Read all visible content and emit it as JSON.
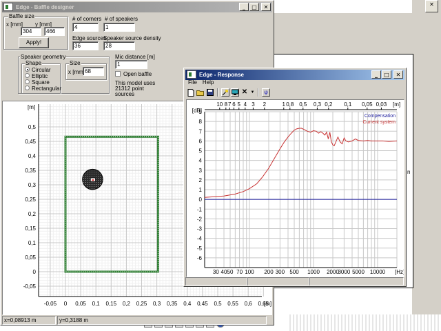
{
  "baffle_window": {
    "title": "Edge - Baffle designer",
    "baffle_size": {
      "group": "Baffle size",
      "x_label": "x [mm]",
      "y_label": "y [mm]",
      "x_value": "304",
      "y_value": "466",
      "apply_label": "Apply!"
    },
    "corners_label": "# of corners",
    "corners_value": "4",
    "speakers_label": "# of speakers",
    "speakers_value": "1",
    "edge_sources_label": "Edge sources",
    "edge_sources_value": "36",
    "density_label": "Speaker source density",
    "density_value": "28",
    "speaker_geometry": {
      "group": "Speaker geometry",
      "shape_group": "Shape",
      "shapes": [
        "Circular",
        "Elliptic",
        "Square",
        "Rectangular"
      ],
      "selected_shape": "Circular",
      "size_group": "Size",
      "size_label": "x [mm]",
      "size_value": "68"
    },
    "mic_distance_label": "Mic distance [m]",
    "mic_distance_value": "1",
    "open_baffle_label": "Open baffle",
    "point_sources_text": [
      "This model uses",
      "21312 point",
      "sources"
    ],
    "plot": {
      "y_unit": "[m]",
      "x_unit": "[m]",
      "y_ticks": [
        "0,5",
        "0,45",
        "0,4",
        "0,35",
        "0,3",
        "0,25",
        "0,2",
        "0,15",
        "0,1",
        "0,05",
        "0",
        "-0,05"
      ],
      "x_ticks": [
        "-0,05",
        "0",
        "0,05",
        "0,1",
        "0,15",
        "0,2",
        "0,25",
        "0,3",
        "0,35",
        "0,4",
        "0,45",
        "0,5",
        "0,55",
        "0,6",
        "0,65"
      ]
    },
    "status_x": "x=0,08913 m",
    "status_y": "y=0,3188 m"
  },
  "response_window": {
    "title": "Edge - Response",
    "menu": [
      "File",
      "Help"
    ],
    "toolbar_icons": [
      "new-file-icon",
      "open-folder-icon",
      "save-disk-icon",
      "star-icon",
      "monitor-icon",
      "delete-x-icon",
      "dropdown-arrow-icon",
      "phi-icon"
    ],
    "legend": [
      {
        "name": "Compensation",
        "color": "#1c1c9c"
      },
      {
        "name": "Current system",
        "color": "#c83232"
      }
    ],
    "y_unit": "[dB]",
    "hz_unit": "[Hz]",
    "m_unit": "[m]"
  },
  "colors": {
    "accent_green": "#2e7d32",
    "compensation_blue": "#1c1c9c",
    "response_red": "#c83232",
    "titlebar_active": "#0a246a"
  },
  "chart_data": {
    "type": "line",
    "x_scale": "log",
    "x_unit": "Hz",
    "xlim": [
      20,
      20000
    ],
    "ylim": [
      -7,
      9
    ],
    "y_ticks": [
      9,
      8,
      7,
      6,
      5,
      4,
      3,
      2,
      1,
      0,
      -1,
      -2,
      -3,
      -4,
      -5,
      -6
    ],
    "y_tick_labels": [
      "9",
      "8",
      "7",
      "6",
      "5",
      "4",
      "3",
      "2",
      "1",
      "0",
      "-1",
      "-2",
      "-3",
      "-4",
      "-5",
      "-6"
    ],
    "x_ticks": [
      30,
      40,
      50,
      70,
      100,
      200,
      300,
      500,
      1000,
      2000,
      3000,
      5000,
      10000
    ],
    "x_tick_labels": [
      "30",
      "40",
      "50",
      "70",
      "100",
      "200",
      "300",
      "500",
      "1000",
      "2000",
      "3000",
      "5000",
      "10000"
    ],
    "top_axis_labels": [
      "10",
      "8",
      "7",
      "6",
      "5",
      "4",
      "3",
      "2",
      "1",
      "0,8",
      "0,5",
      "0,3",
      "0,2",
      "0,1",
      "0,05",
      "0,03"
    ],
    "top_axis_values": [
      10,
      8,
      7,
      6,
      5,
      4,
      3,
      2,
      1,
      0.8,
      0.5,
      0.3,
      0.2,
      0.1,
      0.05,
      0.03
    ],
    "top_axis_unit": "m",
    "grid": true,
    "legend_position": "top-right",
    "series": [
      {
        "name": "Compensation",
        "x": [
          20,
          20000
        ],
        "y": [
          0,
          0
        ]
      },
      {
        "name": "Current system",
        "x": [
          20,
          40,
          60,
          80,
          100,
          130,
          160,
          200,
          250,
          300,
          350,
          400,
          450,
          500,
          550,
          600,
          650,
          700,
          800,
          900,
          1000,
          1100,
          1200,
          1300,
          1400,
          1500,
          1600,
          1700,
          1800,
          1900,
          2000,
          2100,
          2200,
          2400,
          2600,
          2800,
          3000,
          3200,
          3500,
          4000,
          4500,
          5000,
          6000,
          7000,
          8000,
          9000,
          10000,
          12000,
          15000,
          20000
        ],
        "y": [
          0.2,
          0.35,
          0.55,
          0.8,
          1.1,
          1.6,
          2.3,
          3.2,
          4.3,
          5.2,
          5.9,
          6.4,
          6.8,
          7.1,
          7.25,
          7.3,
          7.3,
          7.2,
          7.0,
          6.9,
          7.05,
          7.0,
          6.8,
          6.95,
          6.8,
          6.6,
          6.9,
          6.2,
          6.9,
          5.9,
          5.6,
          5.5,
          5.8,
          6.4,
          5.9,
          5.7,
          6.3,
          6.0,
          5.9,
          6.0,
          6.2,
          6.05,
          6.0,
          6.05,
          6.0,
          6.0,
          6.0,
          6.0,
          5.95,
          6.0
        ]
      }
    ]
  }
}
